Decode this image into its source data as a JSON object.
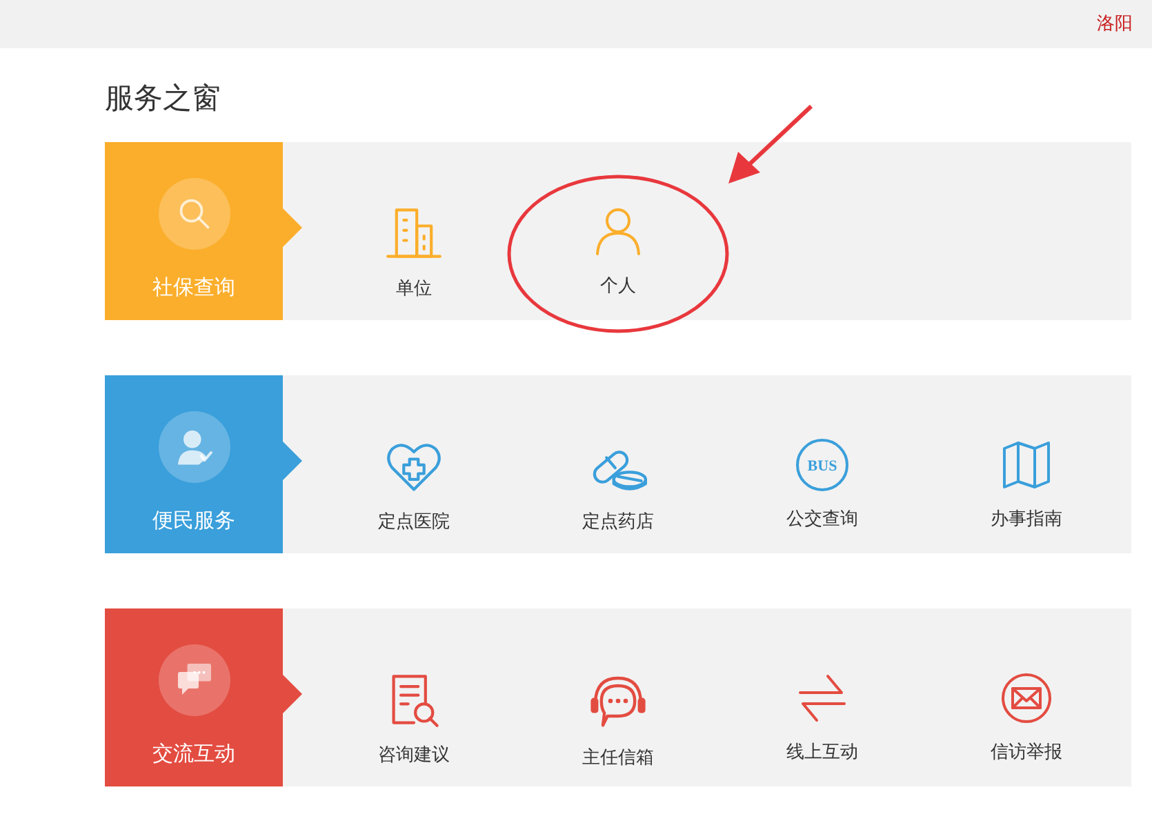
{
  "top_bar": {
    "city": "洛阳"
  },
  "title": "服务之窗",
  "sections": [
    {
      "label": "社保查询",
      "kind": "search",
      "color": "#fbae2b",
      "items": [
        {
          "label": "单位",
          "kind": "building",
          "circled": false
        },
        {
          "label": "个人",
          "kind": "person",
          "circled": true
        }
      ]
    },
    {
      "label": "便民服务",
      "kind": "user",
      "color": "#3a9fdb",
      "items": [
        {
          "label": "定点医院",
          "kind": "heart-plus",
          "circled": false
        },
        {
          "label": "定点药店",
          "kind": "pills",
          "circled": false
        },
        {
          "label": "公交查询",
          "kind": "bus",
          "icon_text": "BUS",
          "circled": false
        },
        {
          "label": "办事指南",
          "kind": "map",
          "circled": false
        }
      ]
    },
    {
      "label": "交流互动",
      "kind": "chat",
      "color": "#e34c41",
      "items": [
        {
          "label": "咨询建议",
          "kind": "document-search",
          "circled": false
        },
        {
          "label": "主任信箱",
          "kind": "headset",
          "circled": false
        },
        {
          "label": "线上互动",
          "kind": "swap",
          "circled": false
        },
        {
          "label": "信访举报",
          "kind": "envelope",
          "circled": false
        }
      ]
    }
  ]
}
